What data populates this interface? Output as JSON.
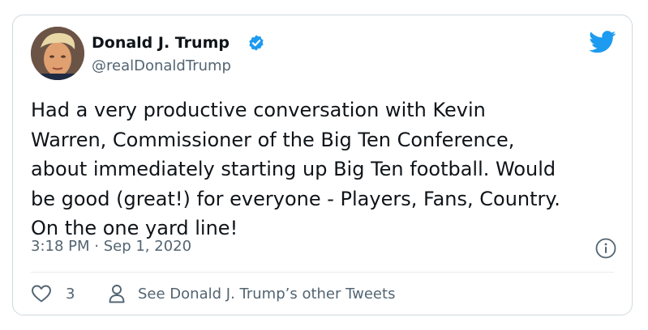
{
  "tweet": {
    "author": {
      "display_name": "Donald J. Trump",
      "handle": "@realDonaldTrump",
      "verified": true
    },
    "text_lines": [
      "Had a very productive conversation with Kevin",
      "Warren, Commissioner of the Big Ten Conference,",
      "about immediately starting up Big Ten football. Would",
      "be good (great!) for everyone - Players, Fans, Country.",
      "On the one yard line!"
    ],
    "timestamp": "3:18 PM · Sep 1, 2020",
    "likes": "3",
    "other_tweets_label": "See Donald J. Trump’s other Tweets"
  },
  "icons": {
    "brand": "twitter-bird-icon",
    "verified": "verified-badge-icon",
    "info": "info-icon",
    "like": "heart-icon",
    "profile": "person-icon"
  },
  "colors": {
    "twitter_blue": "#1d9bf0",
    "text_primary": "#0f1419",
    "text_secondary": "#536471",
    "border": "#cfd9de"
  }
}
